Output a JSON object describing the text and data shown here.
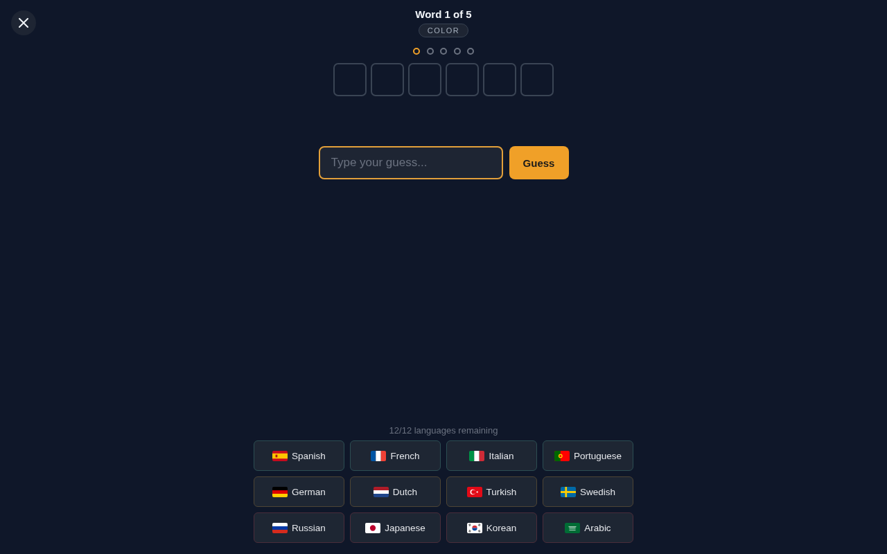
{
  "header": {
    "title": "Word 1 of 5",
    "category": "COLOR"
  },
  "steps": [
    {
      "selected": true
    },
    {
      "selected": false
    },
    {
      "selected": false
    },
    {
      "selected": false
    },
    {
      "selected": false
    }
  ],
  "letter_tiles": [
    {
      "filled": false
    },
    {
      "filled": false
    },
    {
      "filled": false
    },
    {
      "filled": false
    },
    {
      "filled": false
    },
    {
      "filled": false
    }
  ],
  "guess_input": {
    "placeholder": "Type your guess...",
    "focused": true
  },
  "guess_button": {
    "label": "Guess"
  },
  "languages_remaining": "12/12 languages remaining",
  "languages": [
    {
      "name": "Spanish",
      "color": "#2c4d52"
    },
    {
      "name": "French",
      "color": "#2c4d52"
    },
    {
      "name": "Italian",
      "color": "#2c4d52"
    },
    {
      "name": "Portuguese",
      "color": "#2c4d52"
    },
    {
      "name": "German",
      "color": "#4d4434"
    },
    {
      "name": "Dutch",
      "color": "#4d4434"
    },
    {
      "name": "Turkish",
      "color": "#4d4434"
    },
    {
      "name": "Swedish",
      "color": "#4d4434"
    },
    {
      "name": "Russian",
      "color": "#4a2d3a"
    },
    {
      "name": "Japanese",
      "color": "#4a2d3a"
    },
    {
      "name": "Korean",
      "color": "#4a2d3a"
    },
    {
      "name": "Arabic",
      "color": "#4a2d3a"
    }
  ]
}
